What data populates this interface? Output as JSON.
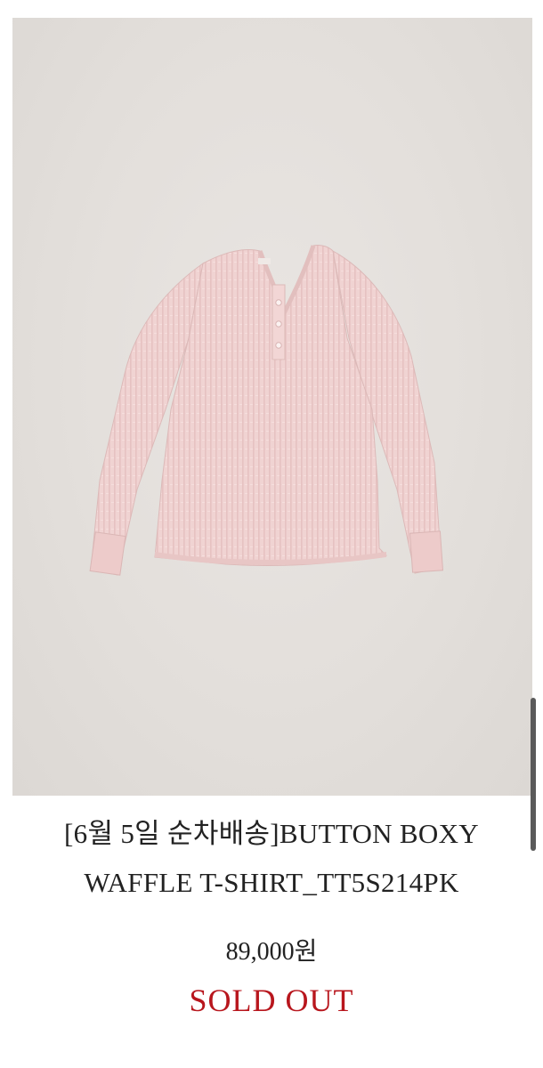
{
  "product": {
    "title_line1": "[6월 5일 순차배송]BUTTON BOXY",
    "title_line2": "WAFFLE T-SHIRT_TT5S214PK",
    "price": "89,000원",
    "status": "SOLD OUT"
  },
  "colors": {
    "background": "#ffffff",
    "image_backdrop": "#e3dfdb",
    "garment_pink": "#efcfcf",
    "sold_out_red": "#b8161d",
    "text": "#222222"
  }
}
